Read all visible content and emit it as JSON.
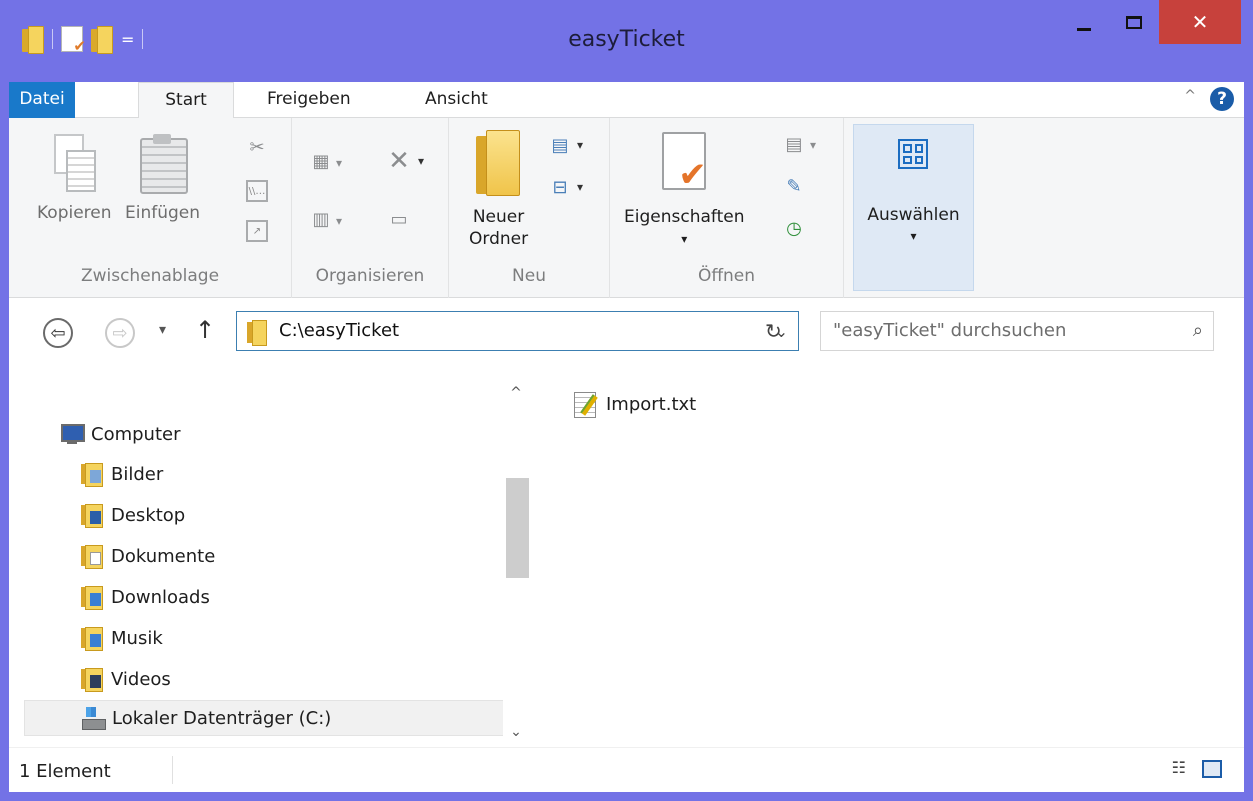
{
  "window": {
    "title": "easyTicket",
    "controls": {
      "minimize": "–",
      "maximize": "□",
      "close": "✕"
    }
  },
  "qat": {
    "dropdown_glyph": "="
  },
  "ribbon": {
    "tabs": [
      {
        "label": "Datei"
      },
      {
        "label": "Start"
      },
      {
        "label": "Freigeben"
      },
      {
        "label": "Ansicht"
      }
    ],
    "collapse_glyph": "^",
    "help_glyph": "?",
    "groups": {
      "clipboard": {
        "label": "Zwischenablage",
        "copy": "Kopieren",
        "paste": "Einfügen"
      },
      "organize": {
        "label": "Organisieren"
      },
      "new": {
        "label": "Neu",
        "new_folder_line1": "Neuer",
        "new_folder_line2": "Ordner"
      },
      "open": {
        "label": "Öffnen",
        "properties": "Eigenschaften"
      },
      "select": {
        "label": "Auswählen"
      }
    }
  },
  "nav": {
    "back_glyph": "⇦",
    "forward_glyph": "⇨",
    "recent_glyph": "▾",
    "up_glyph": "↑",
    "address": "C:\\easyTicket",
    "address_drop": "⌄",
    "refresh_glyph": "↻",
    "search_placeholder": "\"easyTicket\" durchsuchen",
    "search_glyph": "⌕"
  },
  "navpane": {
    "items": [
      {
        "label": "Computer",
        "icon": "computer-icon"
      },
      {
        "label": "Bilder",
        "icon": "pictures-folder-icon"
      },
      {
        "label": "Desktop",
        "icon": "desktop-folder-icon"
      },
      {
        "label": "Dokumente",
        "icon": "documents-folder-icon"
      },
      {
        "label": "Downloads",
        "icon": "downloads-folder-icon"
      },
      {
        "label": "Musik",
        "icon": "music-folder-icon"
      },
      {
        "label": "Videos",
        "icon": "videos-folder-icon"
      },
      {
        "label": "Lokaler Datenträger (C:)",
        "icon": "drive-icon",
        "selected": true
      }
    ],
    "scroll_up_glyph": "^",
    "scroll_down_glyph": "⌄"
  },
  "files": [
    {
      "name": "Import.txt",
      "icon": "text-file-icon"
    }
  ],
  "statusbar": {
    "count": "1 Element",
    "details_glyph": "☷"
  },
  "colors": {
    "frame": "#7372e6",
    "file_tab": "#1979ca",
    "close_button": "#c7413c",
    "address_border": "#3c7fb1"
  }
}
